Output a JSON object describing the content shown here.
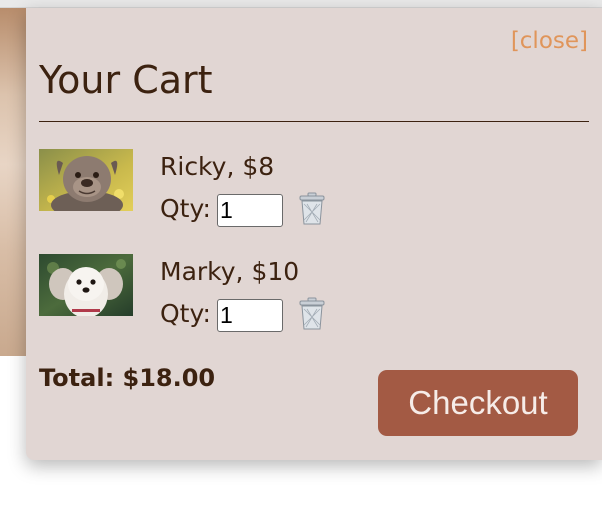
{
  "cart": {
    "close_label": "[close]",
    "title": "Your Cart",
    "qty_label": "Qty:",
    "items": [
      {
        "name_price": "Ricky, $8",
        "qty": "1",
        "image": "bulldog-photo"
      },
      {
        "name_price": "Marky, $10",
        "qty": "1",
        "image": "white-dog-photo"
      }
    ],
    "total": "Total: $18.00",
    "checkout_label": "Checkout"
  },
  "colors": {
    "panel_background": "#e1d6d3",
    "text": "#3c2210",
    "close_link": "#e0955a",
    "checkout_button": "#a35a44"
  },
  "icons": [
    "trash-icon"
  ]
}
